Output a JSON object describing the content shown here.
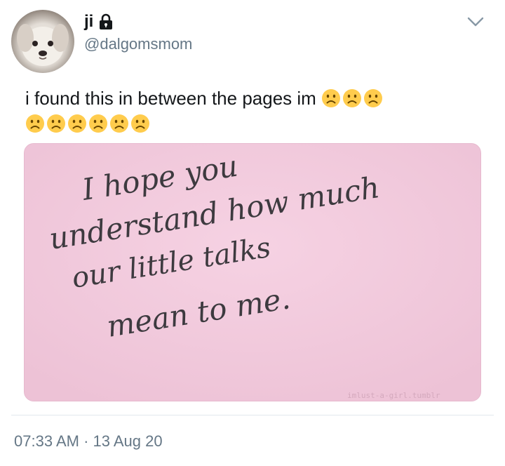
{
  "user": {
    "display_name": "ji",
    "handle": "@dalgomsmom"
  },
  "tweet": {
    "text_line1": "i found this in between the pages im",
    "emoji_line1_count": 3,
    "emoji_line2_count": 6,
    "emoji_name": "frowning-face",
    "timestamp": "07:33 AM · 13 Aug 20"
  },
  "media": {
    "note_line1": "I hope you",
    "note_line2": "understand how much",
    "note_line3": "our little talks",
    "note_line4": "mean to me.",
    "watermark": "imlust-a-girl.tumblr",
    "paper_color": "#f1c8dc",
    "ink_color": "#3d3a3f"
  },
  "colors": {
    "text": "#14171a",
    "secondary": "#657786",
    "divider": "#e1e8ed"
  }
}
